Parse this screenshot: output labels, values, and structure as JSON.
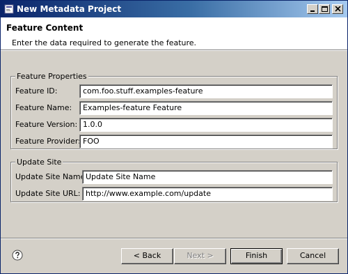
{
  "window": {
    "title": "New Metadata Project",
    "controls": {
      "minimize": "minimize-icon",
      "maximize": "maximize-icon",
      "close": "close-icon"
    }
  },
  "banner": {
    "title": "Feature Content",
    "description": "Enter the data required to generate the feature."
  },
  "feature_properties": {
    "legend": "Feature Properties",
    "fields": [
      {
        "label": "Feature ID:",
        "value": "com.foo.stuff.examples-feature"
      },
      {
        "label": "Feature Name:",
        "value": "Examples-feature Feature"
      },
      {
        "label": "Feature Version:",
        "value": "1.0.0"
      },
      {
        "label": "Feature Provider:",
        "value": "FOO"
      }
    ]
  },
  "update_site": {
    "legend": "Update Site",
    "fields": [
      {
        "label": "Update Site Name:",
        "value": "Update Site Name"
      },
      {
        "label": "Update Site URL:",
        "value": "http://www.example.com/update"
      }
    ]
  },
  "buttons": {
    "back": "< Back",
    "next": "Next >",
    "finish": "Finish",
    "cancel": "Cancel"
  },
  "colors": {
    "titlebar_start": "#0a246a",
    "titlebar_end": "#a6caf0",
    "dialog_bg": "#d4d0c8"
  }
}
